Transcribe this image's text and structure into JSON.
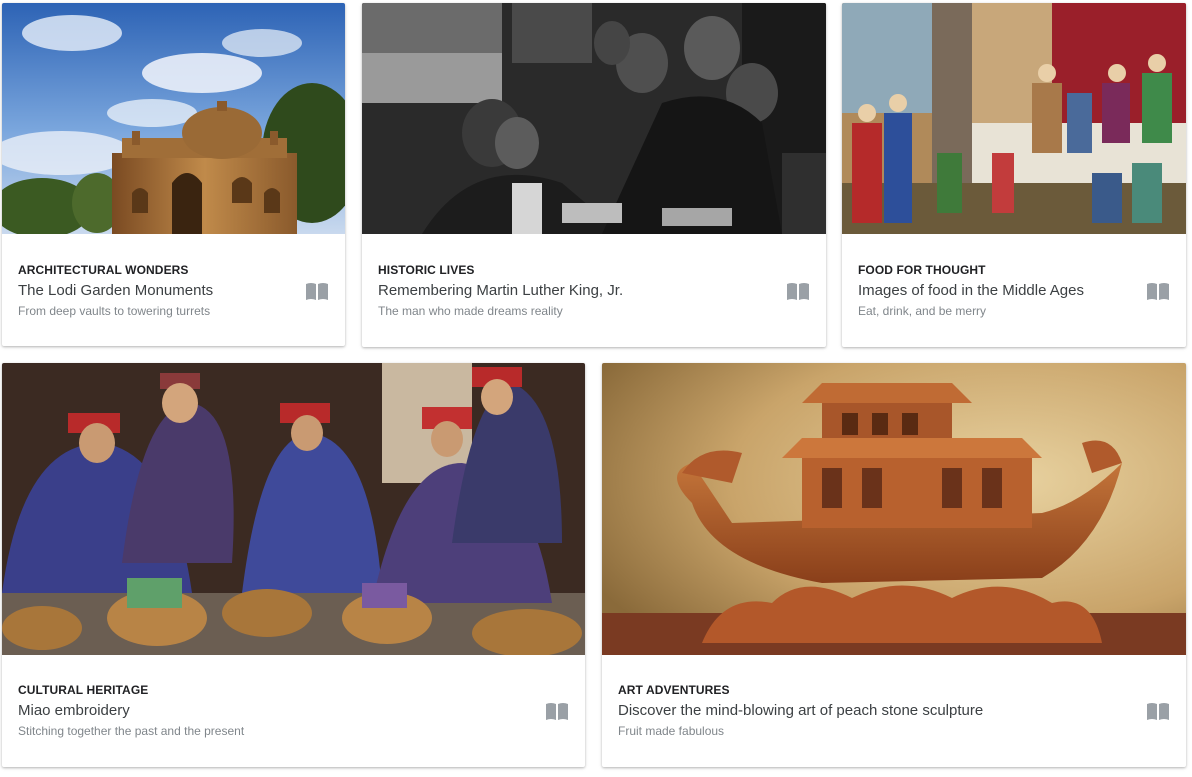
{
  "cards": [
    {
      "category": "ARCHITECTURAL WONDERS",
      "title": "The Lodi Garden Monuments",
      "subtitle": "From deep vaults to towering turrets",
      "image": "domed stone tomb under blue sky"
    },
    {
      "category": "HISTORIC LIVES",
      "title": "Remembering Martin Luther King, Jr.",
      "subtitle": "The man who made dreams reality",
      "image": "black and white photograph of a smiling crowd"
    },
    {
      "category": "FOOD FOR THOUGHT",
      "title": "Images of food in the Middle Ages",
      "subtitle": "Eat, drink, and be merry",
      "image": "medieval illuminated manuscript banquet scene"
    },
    {
      "category": "CULTURAL HERITAGE",
      "title": "Miao embroidery",
      "subtitle": "Stitching together the past and the present",
      "image": "women in embroidered clothing with baskets"
    },
    {
      "category": "ART ADVENTURES",
      "title": "Discover the mind-blowing art of peach stone sculpture",
      "subtitle": "Fruit made fabulous",
      "image": "carved peach stone boat sculpture"
    }
  ],
  "icons": {
    "story": "book-open-icon"
  },
  "colors": {
    "icon": "#9aa0a6",
    "category": "#202124",
    "title": "#3c4043",
    "subtitle": "#80868b"
  }
}
